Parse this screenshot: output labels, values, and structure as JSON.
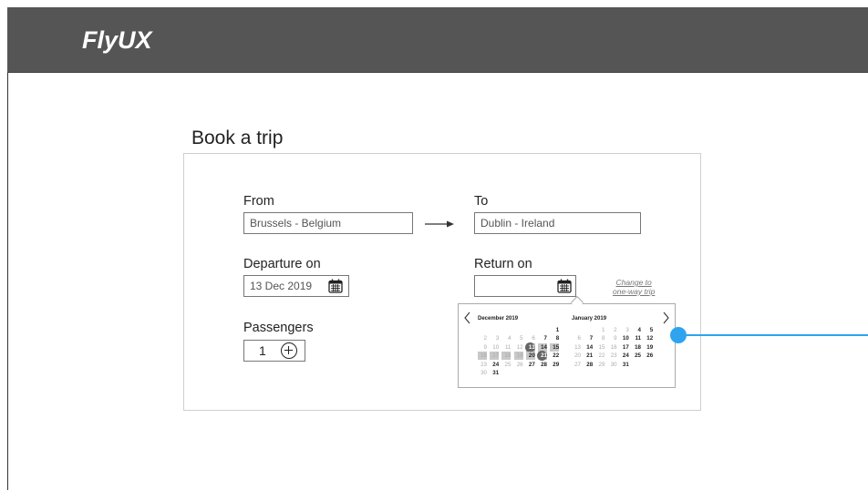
{
  "app": {
    "name": "FlyUX"
  },
  "page": {
    "title": "Book a trip"
  },
  "form": {
    "from": {
      "label": "From",
      "value": "Brussels - Belgium"
    },
    "to": {
      "label": "To",
      "value": "Dublin - Ireland"
    },
    "departure": {
      "label": "Departure on",
      "value": "13 Dec 2019"
    },
    "return": {
      "label": "Return on",
      "value": ""
    },
    "change_link": {
      "line1": "Change to",
      "line2": "one-way trip"
    },
    "passengers": {
      "label": "Passengers",
      "value": "1"
    }
  },
  "datepicker": {
    "left_month": {
      "title": "December 2019",
      "weeks": [
        [
          "",
          "",
          "",
          "",
          "",
          "",
          "1"
        ],
        [
          "2",
          "3",
          "4",
          "5",
          "6",
          "7",
          "8"
        ],
        [
          "9",
          "10",
          "11",
          "12",
          "13",
          "14",
          "15"
        ],
        [
          "16",
          "17",
          "18",
          "19",
          "20",
          "21",
          "22"
        ],
        [
          "23",
          "24",
          "25",
          "26",
          "27",
          "28",
          "29"
        ],
        [
          "30",
          "31",
          "",
          "",
          "",
          "",
          ""
        ]
      ]
    },
    "right_month": {
      "title": "January 2019",
      "weeks": [
        [
          "",
          "",
          "1",
          "2",
          "3",
          "4",
          "5"
        ],
        [
          "6",
          "7",
          "8",
          "9",
          "10",
          "11",
          "12"
        ],
        [
          "13",
          "14",
          "15",
          "16",
          "17",
          "18",
          "19"
        ],
        [
          "20",
          "21",
          "22",
          "23",
          "24",
          "25",
          "26"
        ],
        [
          "27",
          "28",
          "29",
          "30",
          "31",
          "",
          ""
        ]
      ]
    },
    "selected_days": [
      "13",
      "21"
    ],
    "range_start": "13",
    "range_end": "21"
  },
  "colors": {
    "header_bg": "#555555",
    "annotation": "#2ea4f0",
    "selected_day": "#666666",
    "range_day": "#c8c8c8"
  }
}
